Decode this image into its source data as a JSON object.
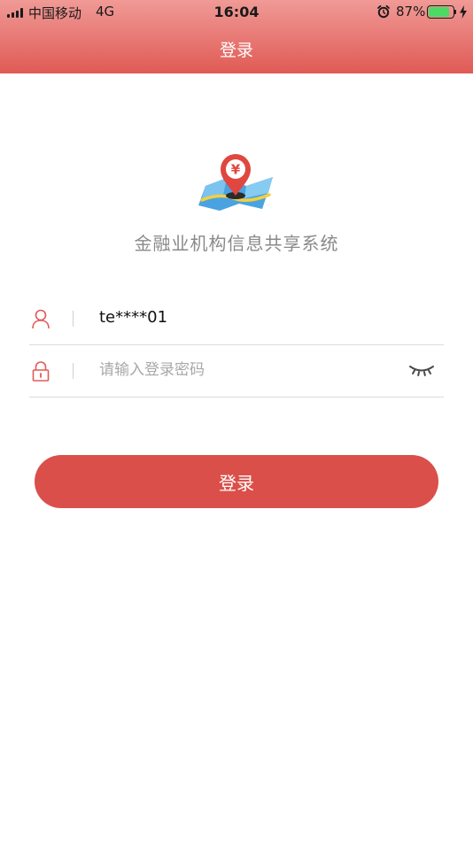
{
  "status_bar": {
    "carrier": "中国移动",
    "network": "4G",
    "time": "16:04",
    "battery_percent": "87%",
    "battery_level": 0.87,
    "icons": [
      "signal-icon",
      "alarm-icon",
      "battery-icon",
      "charging-bolt-icon"
    ]
  },
  "nav": {
    "title": "登录"
  },
  "app": {
    "title": "金融业机构信息共享系统",
    "logo_icon": "map-pin-yuan-logo"
  },
  "form": {
    "username_value": "te****01",
    "username_icon": "user-icon",
    "password_placeholder": "请输入登录密码",
    "password_icon": "lock-icon",
    "visibility_icon": "eye-closed-icon"
  },
  "login_button": {
    "label": "登录"
  },
  "colors": {
    "accent": "#db4f4a",
    "header_top": "#f09a96",
    "header_bottom": "#e05a55",
    "muted_text": "#8a8a8a",
    "battery_green": "#4cd964"
  }
}
